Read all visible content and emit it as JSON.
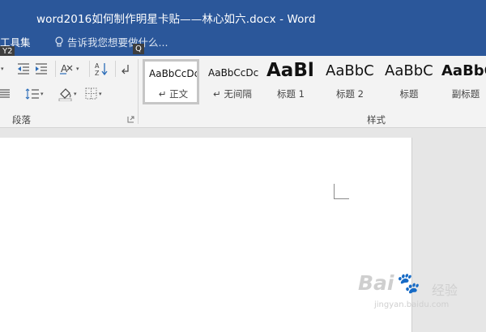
{
  "window": {
    "title": "word2016如何制作明星卡贴——林心如六.docx - Word"
  },
  "tabs": {
    "toolset_label": "工具集",
    "tellme_placeholder": "告诉我您想要做什么..."
  },
  "keytips": {
    "y2": "Y2",
    "q": "Q"
  },
  "ribbon": {
    "paragraph_group_label": "段落",
    "styles_group_label": "样式",
    "icons": [
      "outdent-icon",
      "text-direction-icon",
      "sort-icon",
      "paragraph-mark-icon",
      "line-spacing-icon",
      "shading-icon",
      "borders-icon"
    ]
  },
  "styles": [
    {
      "preview": "AaBbCcDc",
      "name": "正文",
      "mark": "↵",
      "selected": true
    },
    {
      "preview": "AaBbCcDc",
      "name": "无间隔",
      "mark": "↵",
      "selected": false
    },
    {
      "preview": "AaBl",
      "name": "标题 1",
      "mark": "",
      "selected": false
    },
    {
      "preview": "AaBbC",
      "name": "标题 2",
      "mark": "",
      "selected": false
    },
    {
      "preview": "AaBbC",
      "name": "标题",
      "mark": "",
      "selected": false
    },
    {
      "preview": "AaBbC",
      "name": "副标题",
      "mark": "",
      "selected": false
    }
  ],
  "watermark": {
    "brand": "Bai",
    "cn": "经验",
    "url": "jingyan.baidu.com"
  },
  "colors": {
    "title_bar": "#2b579a",
    "ribbon": "#f3f3f3",
    "document_bg": "#e6e6e6",
    "page": "#ffffff"
  }
}
